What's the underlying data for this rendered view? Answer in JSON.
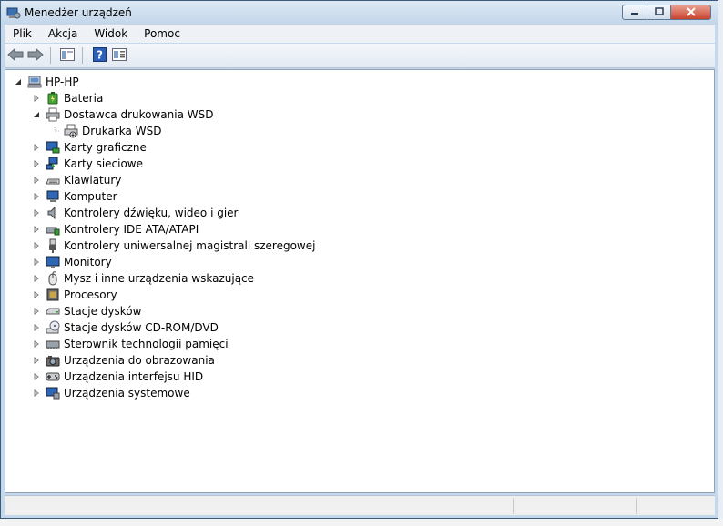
{
  "window": {
    "title": "Menedżer urządzeń",
    "icons": {
      "app": "device-manager-icon",
      "minimize": "minimize-icon",
      "maximize": "maximize-icon",
      "close": "close-icon"
    }
  },
  "menu": [
    "Plik",
    "Akcja",
    "Widok",
    "Pomoc"
  ],
  "toolbar": {
    "buttons": [
      "back-arrow-icon",
      "forward-arrow-icon",
      "show-hide-console-tree-icon",
      "help-icon",
      "properties-icon"
    ]
  },
  "tree": {
    "root": {
      "label": "HP-HP",
      "icon": "computer-icon",
      "expanded": true
    },
    "items": [
      {
        "label": "Bateria",
        "icon": "battery-icon",
        "expanded": false
      },
      {
        "label": "Dostawca drukowania WSD",
        "icon": "printer-icon",
        "expanded": true,
        "children": [
          {
            "label": "Drukarka WSD",
            "icon": "printer-icon"
          }
        ]
      },
      {
        "label": "Karty graficzne",
        "icon": "display-adapter-icon",
        "expanded": false
      },
      {
        "label": "Karty sieciowe",
        "icon": "network-adapter-icon",
        "expanded": false
      },
      {
        "label": "Klawiatury",
        "icon": "keyboard-icon",
        "expanded": false
      },
      {
        "label": "Komputer",
        "icon": "computer-icon",
        "expanded": false
      },
      {
        "label": "Kontrolery dźwięku, wideo i gier",
        "icon": "sound-icon",
        "expanded": false
      },
      {
        "label": "Kontrolery IDE ATA/ATAPI",
        "icon": "ide-controller-icon",
        "expanded": false
      },
      {
        "label": "Kontrolery uniwersalnej magistrali szeregowej",
        "icon": "usb-icon",
        "expanded": false
      },
      {
        "label": "Monitory",
        "icon": "monitor-icon",
        "expanded": false
      },
      {
        "label": "Mysz i inne urządzenia wskazujące",
        "icon": "mouse-icon",
        "expanded": false
      },
      {
        "label": "Procesory",
        "icon": "processor-icon",
        "expanded": false
      },
      {
        "label": "Stacje dysków",
        "icon": "disk-drive-icon",
        "expanded": false
      },
      {
        "label": "Stacje dysków CD-ROM/DVD",
        "icon": "cdrom-icon",
        "expanded": false
      },
      {
        "label": "Sterownik technologii pamięci",
        "icon": "memory-controller-icon",
        "expanded": false
      },
      {
        "label": "Urządzenia do obrazowania",
        "icon": "camera-icon",
        "expanded": false
      },
      {
        "label": "Urządzenia interfejsu HID",
        "icon": "hid-icon",
        "expanded": false
      },
      {
        "label": "Urządzenia systemowe",
        "icon": "system-devices-icon",
        "expanded": false
      }
    ]
  }
}
